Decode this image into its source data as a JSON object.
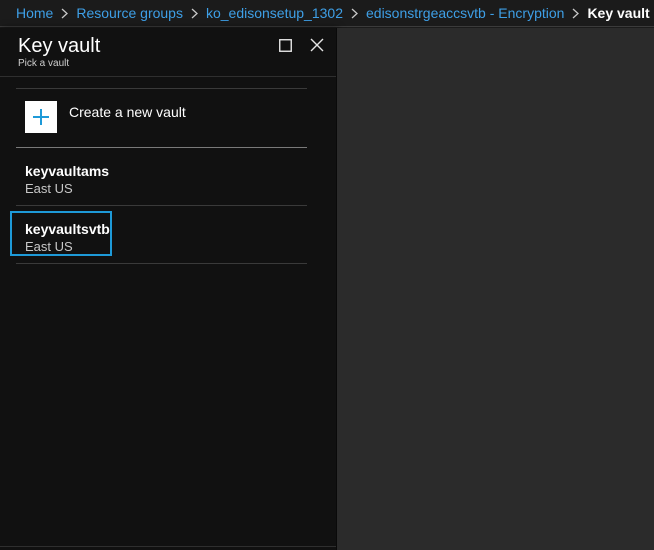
{
  "breadcrumb": {
    "items": [
      {
        "label": "Home"
      },
      {
        "label": "Resource groups"
      },
      {
        "label": "ko_edisonsetup_1302"
      },
      {
        "label": "edisonstrgeaccsvtb - Encryption"
      }
    ],
    "current": "Key vault"
  },
  "blade": {
    "title": "Key vault",
    "subtitle": "Pick a vault",
    "controls": {
      "maximize_icon": "square-icon",
      "close_icon": "close-icon"
    }
  },
  "create": {
    "label": "Create a new vault",
    "icon": "plus-icon",
    "accent": "#1e9ad8"
  },
  "vaults": [
    {
      "name": "keyvaultams",
      "location": "East US",
      "selected": false
    },
    {
      "name": "keyvaultsvtb",
      "location": "East US",
      "selected": true
    }
  ],
  "colors": {
    "link": "#3e9fe6",
    "selection": "#1e9ad8",
    "blade_bg": "#111111",
    "canvas_bg": "#2b2b2b"
  }
}
